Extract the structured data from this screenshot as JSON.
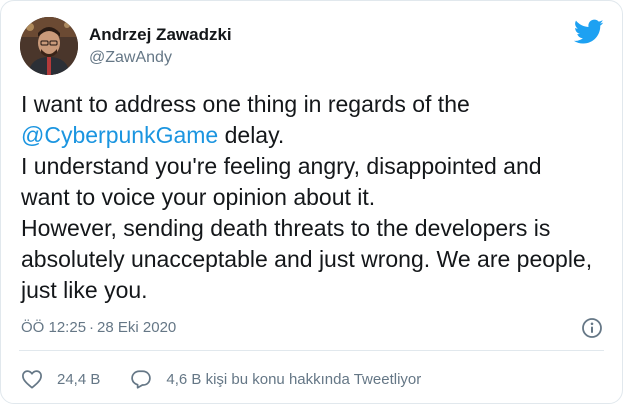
{
  "author": {
    "display_name": "Andrzej Zawadzki",
    "handle": "@ZawAndy",
    "avatar_icon": "avatar-photo"
  },
  "brand": {
    "icon": "twitter-bird-icon",
    "color": "#1da1f2"
  },
  "tweet": {
    "lines": [
      {
        "pre": "I want to address one thing in regards of the",
        "mention": "",
        "post": ""
      },
      {
        "pre": "",
        "mention": "@CyberpunkGame",
        "post": " delay."
      },
      {
        "pre": "I understand you're feeling angry, disappointed and",
        "mention": "",
        "post": ""
      },
      {
        "pre": "want to voice your opinion about it.",
        "mention": "",
        "post": ""
      },
      {
        "pre": "However, sending death threats to the developers is",
        "mention": "",
        "post": ""
      },
      {
        "pre": "absolutely unacceptable and just wrong. We are people,",
        "mention": "",
        "post": ""
      },
      {
        "pre": "just like you.",
        "mention": "",
        "post": ""
      }
    ],
    "mention_color": "#1b95e0"
  },
  "meta": {
    "time": "ÖÖ 12:25",
    "separator": "·",
    "date": "28 Eki 2020",
    "info_icon": "info-icon"
  },
  "actions": {
    "like_icon": "heart-icon",
    "like_count": "24,4 B",
    "reply_icon": "reply-bubble-icon",
    "reply_text": "4,6 B kişi bu konu hakkında Tweetliyor"
  },
  "colors": {
    "text": "#14171a",
    "secondary": "#657786",
    "border": "#e1e8ed"
  }
}
